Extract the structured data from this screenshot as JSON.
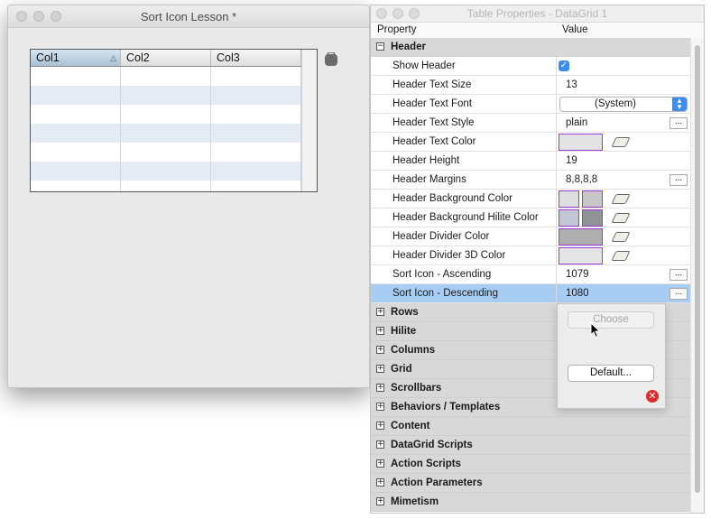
{
  "left_window": {
    "title": "Sort Icon Lesson *",
    "grid": {
      "columns": [
        "Col1",
        "Col2",
        "Col3"
      ],
      "sorted_column": "Col1",
      "sort_direction": "ascending"
    }
  },
  "right_window": {
    "title": "Table Properties - DataGrid 1",
    "columns": {
      "property": "Property",
      "value": "Value"
    },
    "header_section": {
      "label": "Header",
      "show_header": {
        "label": "Show Header",
        "checked": true
      },
      "text_size": {
        "label": "Header Text Size",
        "value": "13"
      },
      "text_font": {
        "label": "Header Text Font",
        "value": "(System)"
      },
      "text_style": {
        "label": "Header Text Style",
        "value": "plain"
      },
      "text_color": {
        "label": "Header Text Color",
        "color": "#e3e3e3"
      },
      "height": {
        "label": "Header Height",
        "value": "19"
      },
      "margins": {
        "label": "Header Margins",
        "value": "8,8,8,8"
      },
      "bg_color": {
        "label": "Header Background Color",
        "colors": [
          "#dedede",
          "#c8c8c8"
        ]
      },
      "bg_hilite_color": {
        "label": "Header Background Hilite Color",
        "colors": [
          "#c3c6d3",
          "#8e9495"
        ]
      },
      "divider_color": {
        "label": "Header Divider Color",
        "color": "#aeaeae"
      },
      "divider_3d_color": {
        "label": "Header Divider 3D Color",
        "color": "#e5e5e5"
      },
      "sort_ascending": {
        "label": "Sort Icon - Ascending",
        "value": "1079"
      },
      "sort_descending": {
        "label": "Sort Icon - Descending",
        "value": "1080"
      }
    },
    "sections": [
      "Rows",
      "Hilite",
      "Columns",
      "Grid",
      "Scrollbars",
      "Behaviors / Templates",
      "Content",
      "DataGrid Scripts",
      "Action Scripts",
      "Action Parameters",
      "Mimetism"
    ]
  },
  "popup": {
    "choose_label": "Choose",
    "default_label": "Default..."
  },
  "glyphs": {
    "ellipsis": "...",
    "expand": "+",
    "collapse": "−",
    "check": "✓",
    "remove": "✕"
  },
  "colors": {
    "selection": "#a8cdf5",
    "accent": "#3b8df5",
    "swatch_border": "#9b3bd6"
  }
}
